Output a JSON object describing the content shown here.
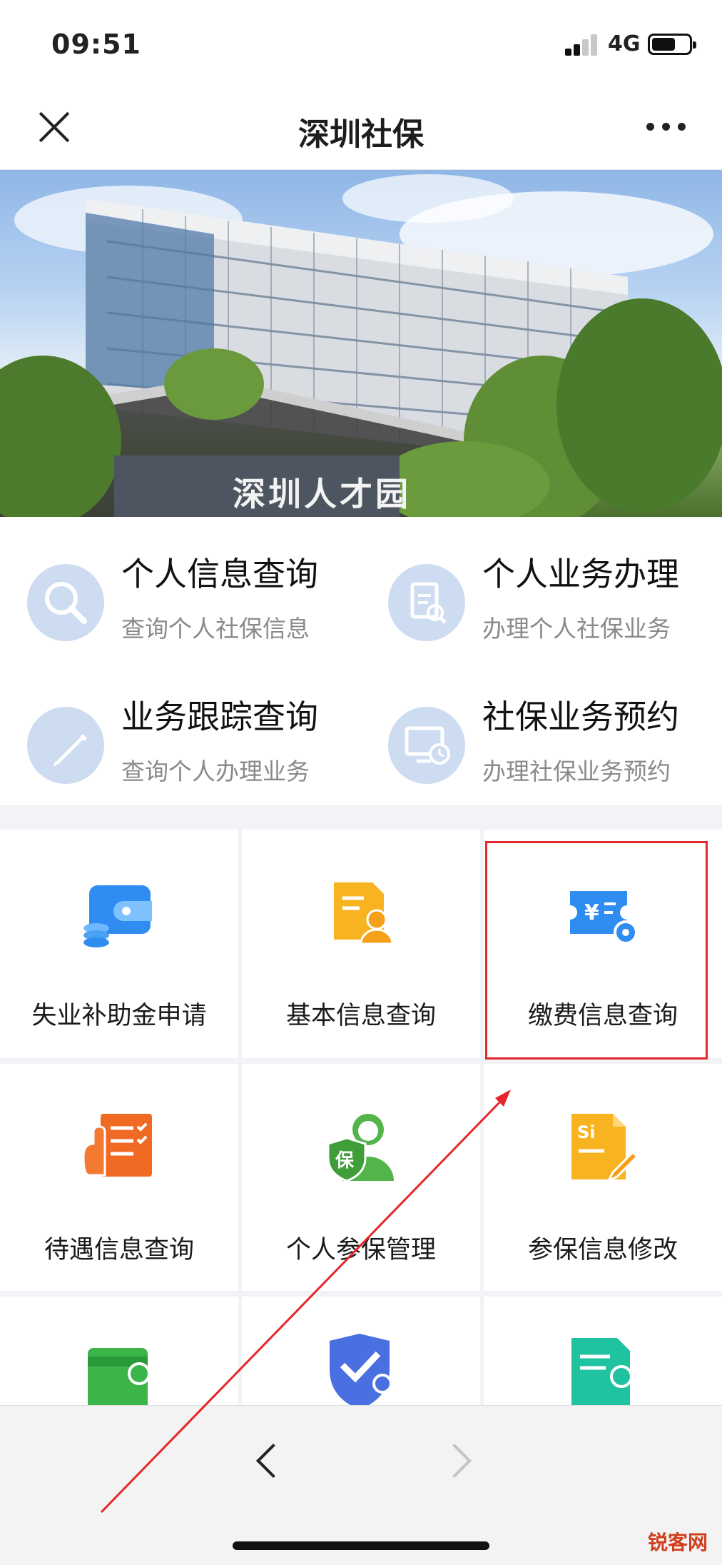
{
  "status_bar": {
    "time": "09:51",
    "network": "4G"
  },
  "nav": {
    "title": "深圳社保"
  },
  "banner": {
    "sign_text": "深圳人才园"
  },
  "quick_actions": [
    {
      "title": "个人信息查询",
      "subtitle": "查询个人社保信息",
      "icon": "search-icon"
    },
    {
      "title": "个人业务办理",
      "subtitle": "办理个人社保业务",
      "icon": "document-edit-icon"
    },
    {
      "title": "业务跟踪查询",
      "subtitle": "查询个人办理业务",
      "icon": "pencil-icon"
    },
    {
      "title": "社保业务预约",
      "subtitle": "办理社保业务预约",
      "icon": "monitor-clock-icon"
    }
  ],
  "services": [
    {
      "label": "失业补助金申请",
      "icon": "wallet-icon",
      "color": "#2f8cf0"
    },
    {
      "label": "基本信息查询",
      "icon": "profile-card-icon",
      "color": "#f8b321"
    },
    {
      "label": "缴费信息查询",
      "icon": "payment-settings-icon",
      "color": "#2f8cf0"
    },
    {
      "label": "待遇信息查询",
      "icon": "hand-checklist-icon",
      "color": "#f06a24"
    },
    {
      "label": "个人参保管理",
      "icon": "insured-person-icon",
      "color": "#53b449"
    },
    {
      "label": "参保信息修改",
      "icon": "si-edit-icon",
      "color": "#f8b321"
    },
    {
      "label": "",
      "icon": "card-settings-icon",
      "color": "#3bb54a"
    },
    {
      "label": "",
      "icon": "shield-check-icon",
      "color": "#4a6fe0"
    },
    {
      "label": "",
      "icon": "list-settings-icon",
      "color": "#20c3a0"
    }
  ],
  "watermark": "锐客网",
  "colors": {
    "highlight": "#e5262a",
    "arrow": "#e5262a"
  }
}
